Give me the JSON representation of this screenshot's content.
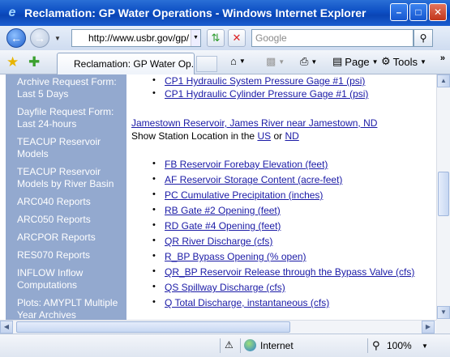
{
  "window": {
    "title": "Reclamation: GP Water Operations - Windows Internet Explorer",
    "controls": [
      "minimize",
      "maximize",
      "close"
    ]
  },
  "addressbar": {
    "url": "http://www.usbr.gov/gp/",
    "search_placeholder": "Google"
  },
  "commandbar": {
    "tab_title": "Reclamation: GP Water Op...",
    "page_label": "Page",
    "tools_label": "Tools"
  },
  "sidebar": {
    "items": [
      {
        "line1": "Archive Request Form:",
        "line2": "Last 5 Days"
      },
      {
        "line1": "Dayfile Request Form:",
        "line2": "Last 24-hours"
      },
      {
        "line1": "TEACUP Reservoir",
        "line2": "Models"
      },
      {
        "line1": "TEACUP Reservoir",
        "line2": "Models by River Basin"
      },
      {
        "line1": "ARC040 Reports",
        "line2": ""
      },
      {
        "line1": "ARC050 Reports",
        "line2": ""
      },
      {
        "line1": "ARCPOR Reports",
        "line2": ""
      },
      {
        "line1": "RES070 Reports",
        "line2": ""
      },
      {
        "line1": "INFLOW Inflow",
        "line2": "Computations"
      },
      {
        "line1": "Plots: AMYPLT Multiple",
        "line2": "Year Archives"
      }
    ]
  },
  "main": {
    "top_links": [
      "CP1 Hydraulic System Pressure Gage #1 (psi)",
      "CP1 Hydraulic Cylinder Pressure Gage #1 (psi)"
    ],
    "station_title": "Jamestown Reservoir, James River near Jamestown, ND",
    "station_location_prefix": "Show Station Location in the ",
    "loc_us": "US",
    "loc_or": " or ",
    "loc_nd": "ND",
    "parameters": [
      "FB Reservoir Forebay Elevation (feet)",
      "AF Reservoir Storage Content (acre-feet)",
      "PC Cumulative Precipitation (inches)",
      "RB Gate #2 Opening (feet)",
      "RD Gate #4 Opening (feet)",
      "QR River Discharge (cfs)",
      "R_BP Bypass Opening (% open)",
      "QR_BP Reservoir Release through the Bypass Valve (cfs)",
      "QS Spillway Discharge (cfs)",
      "Q Total Discharge, instantaneous (cfs)"
    ]
  },
  "statusbar": {
    "zone": "Internet",
    "zoom": "100%"
  }
}
